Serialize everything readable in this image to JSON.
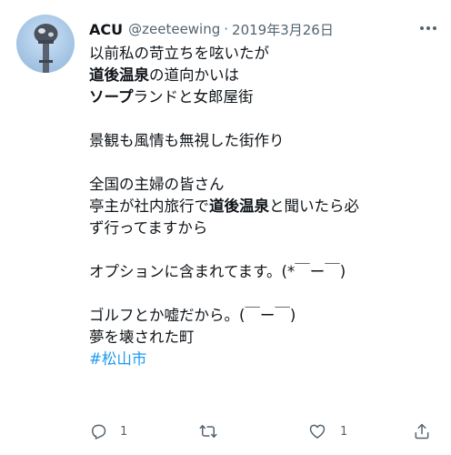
{
  "tweet": {
    "author": {
      "name": "ACU",
      "handle": "@zeeteewing",
      "separator": "·",
      "date": "2019年3月26日"
    },
    "lines": [
      {
        "segments": [
          {
            "text": "以前私の苛立ちを呟いたが",
            "bold": false
          }
        ]
      },
      {
        "segments": [
          {
            "text": "道後温泉",
            "bold": true
          },
          {
            "text": "の道向かいは",
            "bold": false
          }
        ]
      },
      {
        "segments": [
          {
            "text": "ソープ",
            "bold": true
          },
          {
            "text": "ランドと女郎屋街",
            "bold": false
          }
        ]
      },
      {
        "blank": true
      },
      {
        "segments": [
          {
            "text": "景観も風情も無視した街作り",
            "bold": false
          }
        ]
      },
      {
        "blank": true
      },
      {
        "segments": [
          {
            "text": "全国の主婦の皆さん",
            "bold": false
          }
        ]
      },
      {
        "segments": [
          {
            "text": "亭主が社内旅行で",
            "bold": false
          },
          {
            "text": "道後温泉",
            "bold": true
          },
          {
            "text": "と聞いたら必",
            "bold": false
          }
        ]
      },
      {
        "segments": [
          {
            "text": "ず行ってますから",
            "bold": false
          }
        ]
      },
      {
        "blank": true
      },
      {
        "segments": [
          {
            "text": "オプションに含まれてます。(*￣ー￣)",
            "bold": false
          }
        ]
      },
      {
        "blank": true
      },
      {
        "segments": [
          {
            "text": "ゴルフとか嘘だから。(￣ー￣)",
            "bold": false
          }
        ]
      },
      {
        "segments": [
          {
            "text": "夢を壊された町",
            "bold": false
          }
        ]
      },
      {
        "segments": [
          {
            "text": "#松山市",
            "hashtag": true
          }
        ]
      }
    ],
    "actions": {
      "reply_count": "1",
      "retweet_count": "",
      "like_count": "1"
    },
    "icons": {
      "more": "more-icon",
      "reply": "reply-icon",
      "retweet": "retweet-icon",
      "like": "like-icon",
      "share": "share-icon"
    },
    "colors": {
      "text": "#0f1419",
      "secondary": "#536471",
      "hashtag": "#1d9bf0"
    }
  }
}
